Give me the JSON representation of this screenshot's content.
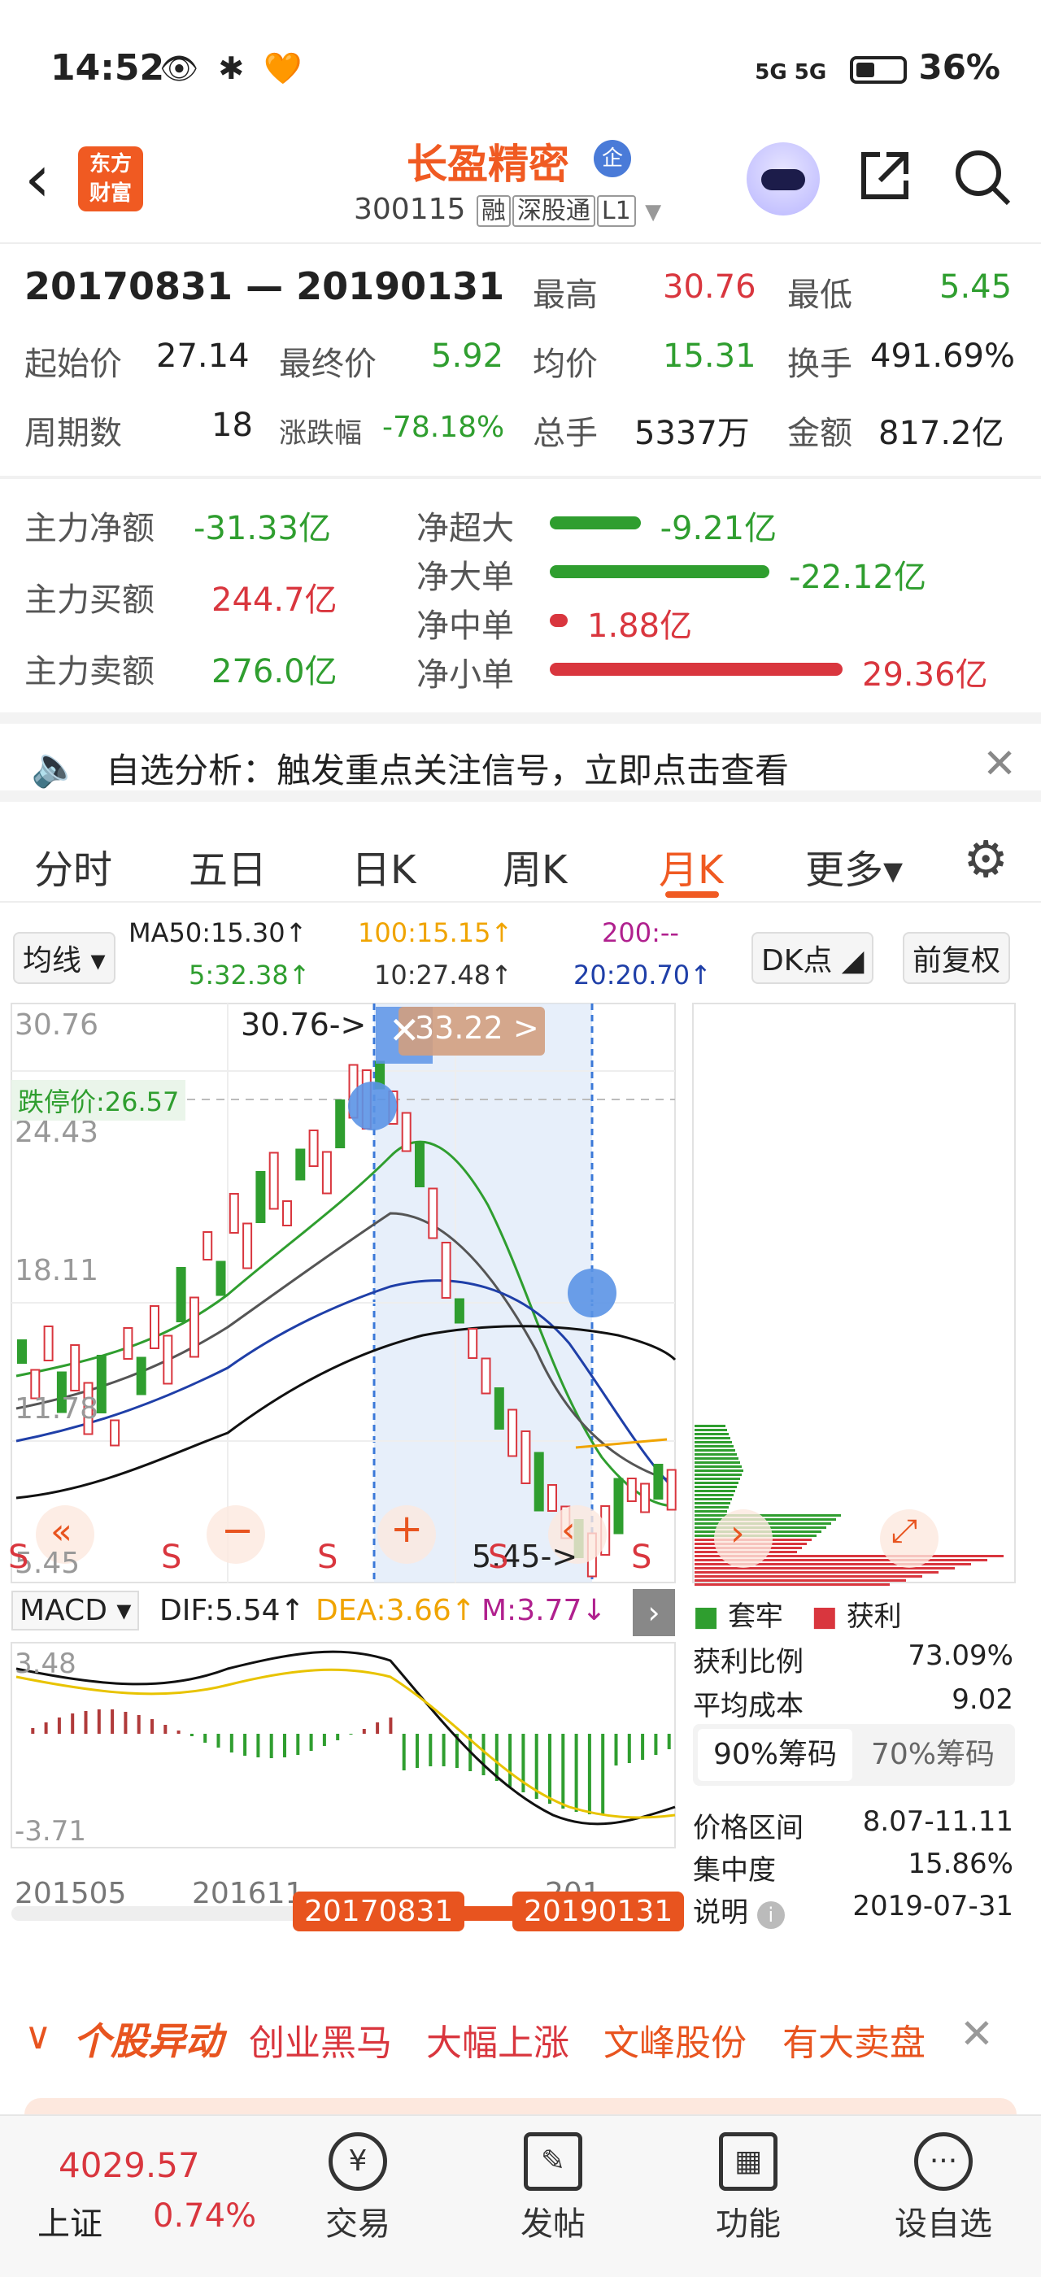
{
  "status": {
    "time": "14:52",
    "icons": "👁 ✱ 🧡",
    "network": "5G 5G",
    "battery": "36%"
  },
  "header": {
    "logo": "东方\n财富",
    "title": "长盈精密",
    "title_badge": "企",
    "code": "300115",
    "tag1": "融",
    "tag2": "深股通",
    "tag3": "L1"
  },
  "stats": {
    "range": "20170831 — 20190131",
    "high_label": "最高",
    "high": "30.76",
    "low_label": "最低",
    "low": "5.45",
    "open_label": "起始价",
    "open": "27.14",
    "close_label": "最终价",
    "close": "5.92",
    "avg_label": "均价",
    "avg": "15.31",
    "turnover_label": "换手",
    "turnover": "491.69%",
    "periods_label": "周期数",
    "periods": "18",
    "change_label": "涨跌幅",
    "change": "-78.18%",
    "vol_label": "总手",
    "vol": "5337万",
    "amount_label": "金额",
    "amount": "817.2亿"
  },
  "flow": {
    "net_label": "主力净额",
    "net": "-31.33亿",
    "buy_label": "主力买额",
    "buy": "244.7亿",
    "sell_label": "主力卖额",
    "sell": "276.0亿",
    "items": [
      {
        "label": "净超大",
        "value": "-9.21亿",
        "ratio": 0.31,
        "color": "#2f9e2f"
      },
      {
        "label": "净大单",
        "value": "-22.12亿",
        "ratio": 0.75,
        "color": "#2f9e2f"
      },
      {
        "label": "净中单",
        "value": "1.88亿",
        "ratio": 0.06,
        "color": "#d9363e"
      },
      {
        "label": "净小单",
        "value": "29.36亿",
        "ratio": 1.0,
        "color": "#d9363e"
      }
    ]
  },
  "banner": {
    "text": "自选分析：触发重点关注信号，立即点击查看"
  },
  "tabs": [
    "分时",
    "五日",
    "日K",
    "周K",
    "月K",
    "更多▾"
  ],
  "ma": {
    "selector": "均线 ▾",
    "ma50": "MA50:15.30↑",
    "ma100": "100:15.15↑",
    "ma200": "200:--",
    "ma5": "5:32.38↑",
    "ma10": "10:27.48↑",
    "ma20": "20:20.70↑",
    "dk": "DK点 ◢",
    "fq": "前复权"
  },
  "chart": {
    "y_labels": [
      "30.76",
      "24.43",
      "18.11",
      "11.78",
      "5.45"
    ],
    "limit_label": "跌停价:26.57",
    "high_marker": "30.76->",
    "low_marker": "5.45->",
    "close_chip": "33.22 >",
    "macd_label": "MACD ▾",
    "dif": "DIF:5.54↑",
    "dea": "DEA:3.66↑",
    "m": "M:3.77↓",
    "macd_top": "3.48",
    "macd_bottom": "-3.71",
    "x_labels": [
      "201505",
      "201611",
      "201"
    ],
    "start_chip": "20170831",
    "end_chip": "20190131",
    "s_marks": [
      "S",
      "S",
      "S",
      "S",
      "S"
    ]
  },
  "chips": {
    "legend_a": "套牢",
    "legend_b": "获利",
    "profit_ratio_label": "获利比例",
    "profit_ratio": "73.09%",
    "avg_cost_label": "平均成本",
    "avg_cost": "9.02",
    "tab90": "90%筹码",
    "tab70": "70%筹码",
    "price_range_label": "价格区间",
    "price_range": "8.07-11.11",
    "concentration_label": "集中度",
    "concentration": "15.86%",
    "note_label": "说明",
    "note_date": "2019-07-31"
  },
  "ticker": {
    "label": "个股异动",
    "items": [
      "创业黑马",
      "大幅上涨",
      "文峰股份",
      "有大卖盘"
    ]
  },
  "nav": {
    "index_value": "4029.57",
    "index_name": "上证",
    "index_change": "0.74%",
    "items": [
      "交易",
      "发帖",
      "功能",
      "设自选"
    ]
  }
}
